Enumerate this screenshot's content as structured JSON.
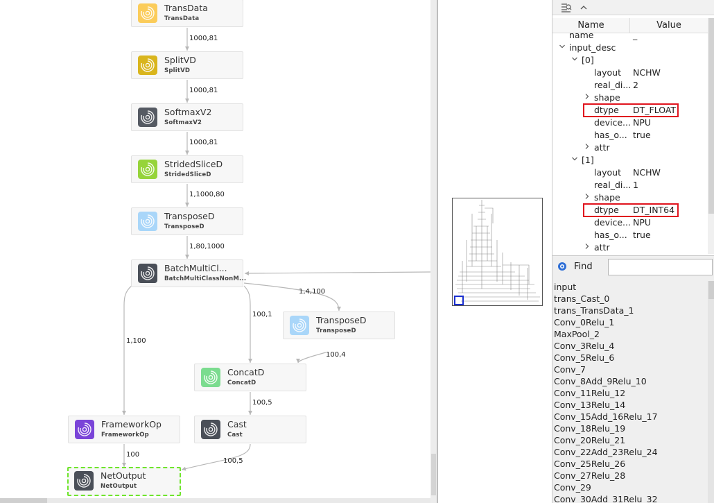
{
  "graph": {
    "nodes": [
      {
        "title": "TransData",
        "sub": "TransData",
        "icon": "transdata-op-icon",
        "color": "#fbcc5a"
      },
      {
        "title": "SplitVD",
        "sub": "SplitVD",
        "icon": "splitvd-op-icon",
        "color": "#d9b51d"
      },
      {
        "title": "SoftmaxV2",
        "sub": "SoftmaxV2",
        "icon": "softmax-op-icon",
        "color": "#555a63"
      },
      {
        "title": "StridedSliceD",
        "sub": "StridedSliceD",
        "icon": "stridedslice-op-icon",
        "color": "#96d43a"
      },
      {
        "title": "TransposeD",
        "sub": "TransposeD",
        "icon": "transpose-op-icon",
        "color": "#a9d6f9"
      },
      {
        "title": "BatchMultiCl...",
        "sub": "BatchMultiClassNonM...",
        "icon": "batchmulticlass-op-icon",
        "color": "#4a4f58"
      },
      {
        "title": "TransposeD",
        "sub": "TransposeD",
        "icon": "transpose-op-icon",
        "color": "#a9d6f9"
      },
      {
        "title": "ConcatD",
        "sub": "ConcatD",
        "icon": "concat-op-icon",
        "color": "#7bdc8f"
      },
      {
        "title": "FrameworkOp",
        "sub": "FrameworkOp",
        "icon": "frameworkop-icon",
        "color": "#7a44d8"
      },
      {
        "title": "Cast",
        "sub": "Cast",
        "icon": "cast-op-icon",
        "color": "#4a4f58"
      },
      {
        "title": "NetOutput",
        "sub": "NetOutput",
        "icon": "netoutput-op-icon",
        "color": "#4a4f58"
      }
    ],
    "edge_labels": [
      "1000,81",
      "1000,81",
      "1000,81",
      "1,1000,80",
      "1,80,1000",
      "1,4,100",
      "100,1",
      "1,100",
      "100,4",
      "100,5",
      "100",
      "100,5"
    ]
  },
  "properties": {
    "toolbar_icons": [
      "filter-icon",
      "collapse-up-icon"
    ],
    "header": {
      "name": "Name",
      "value": "Value"
    },
    "rows": [
      {
        "name": "name",
        "value": "_",
        "chev": "",
        "truncated_top": true
      },
      {
        "name": "input_desc",
        "value": "",
        "chev": "down"
      },
      {
        "name": "[0]",
        "value": "",
        "chev": "down"
      },
      {
        "name": "layout",
        "value": "NCHW",
        "chev": ""
      },
      {
        "name": "real_di...",
        "value": "2",
        "chev": ""
      },
      {
        "name": "shape",
        "value": "",
        "chev": "right"
      },
      {
        "name": "dtype",
        "value": "DT_FLOAT",
        "chev": "",
        "highlight": true
      },
      {
        "name": "device...",
        "value": "NPU",
        "chev": ""
      },
      {
        "name": "has_o...",
        "value": "true",
        "chev": ""
      },
      {
        "name": "attr",
        "value": "",
        "chev": "right"
      },
      {
        "name": "[1]",
        "value": "",
        "chev": "down"
      },
      {
        "name": "layout",
        "value": "NCHW",
        "chev": ""
      },
      {
        "name": "real_di...",
        "value": "1",
        "chev": ""
      },
      {
        "name": "shape",
        "value": "",
        "chev": "right"
      },
      {
        "name": "dtype",
        "value": "DT_INT64",
        "chev": "",
        "highlight": true
      },
      {
        "name": "device...",
        "value": "NPU",
        "chev": ""
      },
      {
        "name": "has_o...",
        "value": "true",
        "chev": ""
      },
      {
        "name": "attr",
        "value": "",
        "chev": "right"
      }
    ],
    "highlight_color": "#e0141e"
  },
  "find": {
    "label": "Find",
    "input_value": "",
    "icon": "find-icon",
    "items": [
      "input",
      "trans_Cast_0",
      "trans_TransData_1",
      "Conv_0Relu_1",
      "MaxPool_2",
      "Conv_3Relu_4",
      "Conv_5Relu_6",
      "Conv_7",
      "Conv_8Add_9Relu_10",
      "Conv_11Relu_12",
      "Conv_13Relu_14",
      "Conv_15Add_16Relu_17",
      "Conv_18Relu_19",
      "Conv_20Relu_21",
      "Conv_22Add_23Relu_24",
      "Conv_25Relu_26",
      "Conv_27Relu_28",
      "Conv_29",
      "Conv_30Add_31Relu_32"
    ]
  },
  "minimap": {
    "viewport_color": "#1a2fd0"
  },
  "colors": {
    "edge": "#b7b7b7",
    "selected_border": "#6fe52c"
  }
}
